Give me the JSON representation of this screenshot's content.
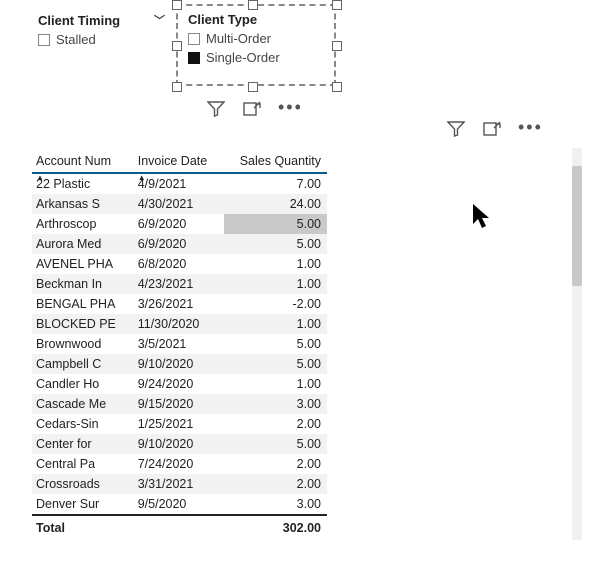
{
  "slicers": {
    "timing": {
      "title": "Client Timing",
      "items": [
        {
          "label": "Stalled",
          "checked": false
        }
      ]
    },
    "type": {
      "title": "Client Type",
      "items": [
        {
          "label": "Multi-Order",
          "checked": false
        },
        {
          "label": "Single-Order",
          "checked": true
        }
      ]
    }
  },
  "table": {
    "headers": {
      "col0": "Account Num",
      "col1": "Invoice Date",
      "col2": "Sales Quantity"
    },
    "rows": [
      {
        "c0": "22 Plastic",
        "c1": "4/9/2021",
        "c2": "7.00"
      },
      {
        "c0": "Arkansas S",
        "c1": "4/30/2021",
        "c2": "24.00"
      },
      {
        "c0": "Arthroscop",
        "c1": "6/9/2020",
        "c2": "5.00",
        "hl": true
      },
      {
        "c0": "Aurora Med",
        "c1": "6/9/2020",
        "c2": "5.00"
      },
      {
        "c0": "AVENEL PHA",
        "c1": "6/8/2020",
        "c2": "1.00"
      },
      {
        "c0": "Beckman In",
        "c1": "4/23/2021",
        "c2": "1.00"
      },
      {
        "c0": "BENGAL PHA",
        "c1": "3/26/2021",
        "c2": "-2.00"
      },
      {
        "c0": "BLOCKED PE",
        "c1": "11/30/2020",
        "c2": "1.00"
      },
      {
        "c0": "Brownwood",
        "c1": "3/5/2021",
        "c2": "5.00"
      },
      {
        "c0": "Campbell C",
        "c1": "9/10/2020",
        "c2": "5.00"
      },
      {
        "c0": "Candler Ho",
        "c1": "9/24/2020",
        "c2": "1.00"
      },
      {
        "c0": "Cascade Me",
        "c1": "9/15/2020",
        "c2": "3.00"
      },
      {
        "c0": "Cedars-Sin",
        "c1": "1/25/2021",
        "c2": "2.00"
      },
      {
        "c0": "Center for",
        "c1": "9/10/2020",
        "c2": "5.00"
      },
      {
        "c0": "Central Pa",
        "c1": "7/24/2020",
        "c2": "2.00"
      },
      {
        "c0": "Crossroads",
        "c1": "3/31/2021",
        "c2": "2.00"
      },
      {
        "c0": "Denver Sur",
        "c1": "9/5/2020",
        "c2": "3.00"
      }
    ],
    "total": {
      "label": "Total",
      "value": "302.00"
    }
  }
}
